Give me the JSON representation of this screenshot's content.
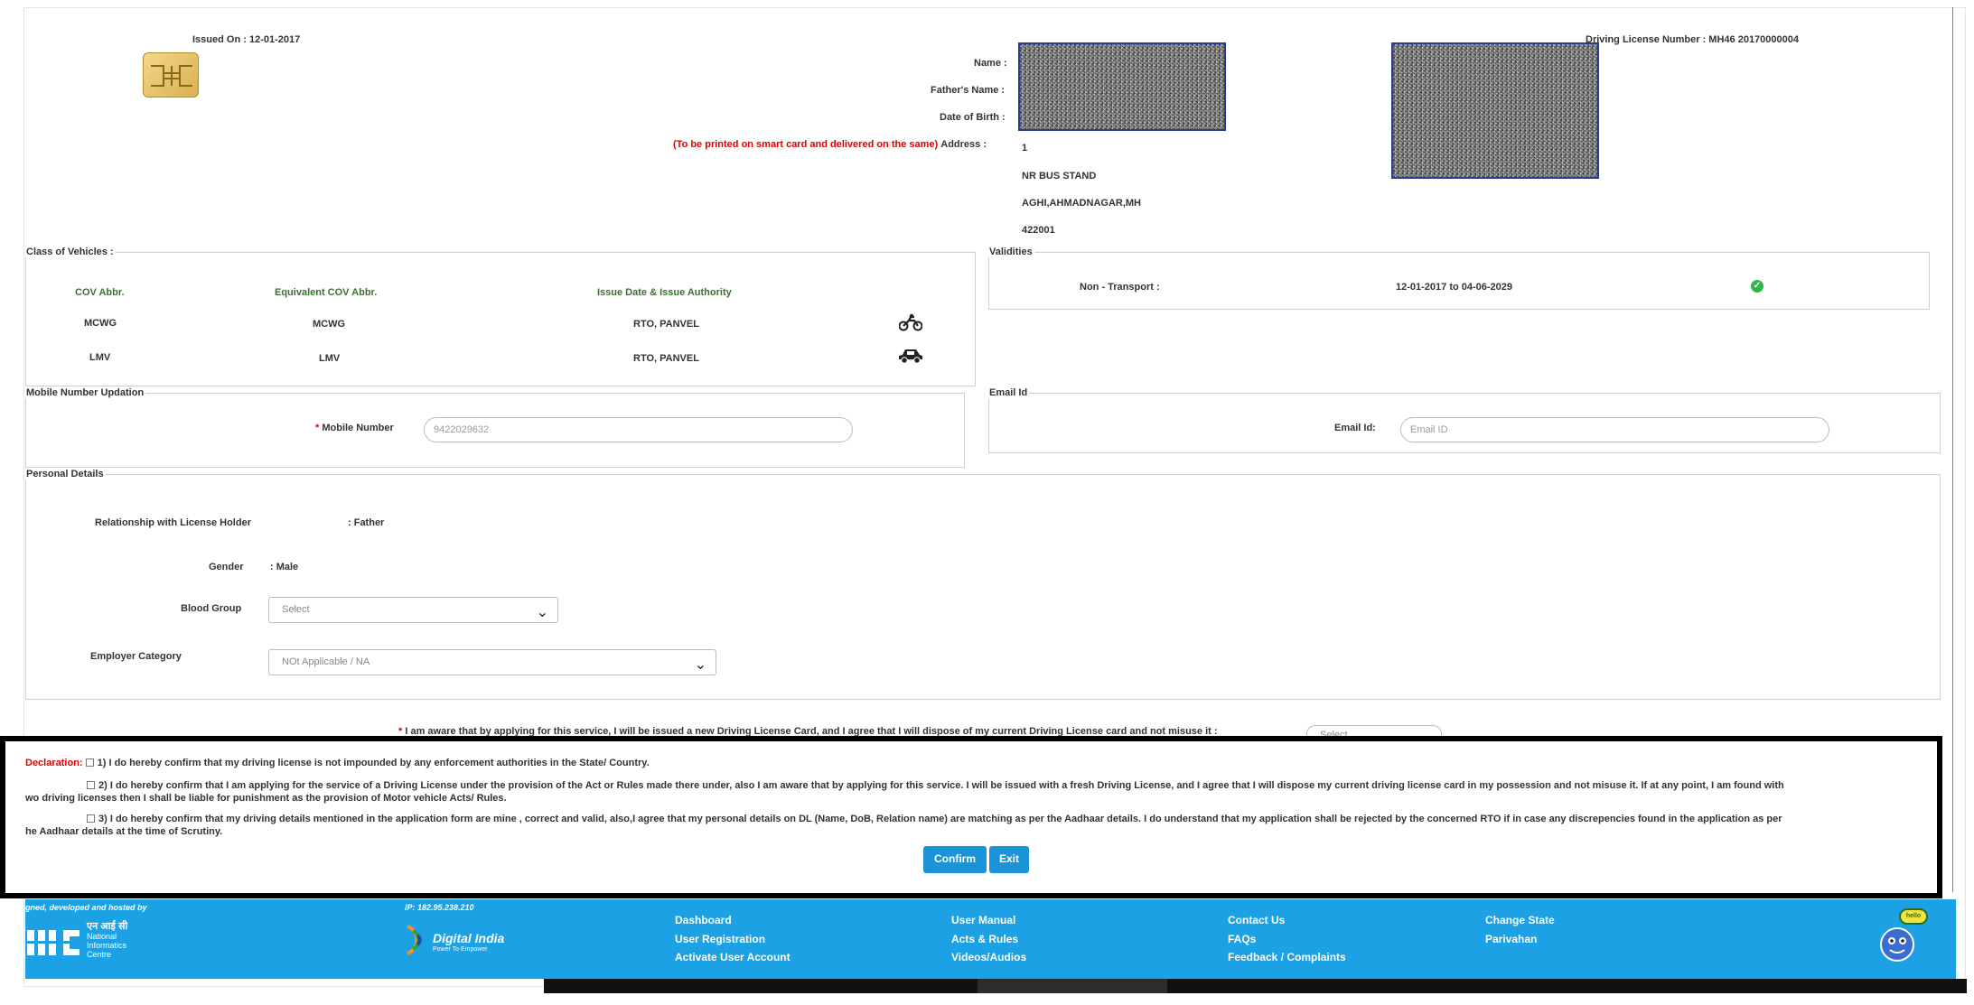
{
  "header": {
    "issued_on": "Issued On : 12-01-2017",
    "dl_number": "Driving License Number : MH46 20170000004",
    "name_label": "Name :",
    "father_label": "Father's Name :",
    "dob_label": "Date of Birth :",
    "print_note": "(To be printed on smart card and delivered on the same)",
    "address_label": "Address :",
    "address_lines": [
      "1",
      "NR BUS STAND",
      "AGHI,AHMADNAGAR,MH",
      "422001"
    ]
  },
  "cov": {
    "legend": "Class of Vehicles :",
    "headers": [
      "COV Abbr.",
      "Equivalent COV Abbr.",
      "Issue Date & Issue Authority"
    ],
    "rows": [
      {
        "abbr": "MCWG",
        "equiv": "MCWG",
        "authority": "RTO, PANVEL",
        "icon": "motorcycle-icon"
      },
      {
        "abbr": "LMV",
        "equiv": "LMV",
        "authority": "RTO, PANVEL",
        "icon": "car-icon"
      }
    ]
  },
  "validities": {
    "legend": "Validities",
    "type": "Non - Transport :",
    "range": "12-01-2017 to 04-06-2029",
    "status_color": "#2fb84a"
  },
  "mobile": {
    "legend": "Mobile Number Updation",
    "required": "*",
    "label": "Mobile Number",
    "value": "9422029632"
  },
  "email": {
    "legend": "Email Id",
    "label": "Email Id:",
    "placeholder": "Email ID"
  },
  "personal": {
    "legend": "Personal Details",
    "relationship_label": "Relationship with License Holder",
    "relationship_value": ": Father",
    "gender_label": "Gender",
    "gender_value": ": Male",
    "blood_label": "Blood Group",
    "blood_value": "Select",
    "employer_label": "Employer Category",
    "employer_value": "NOt Applicable / NA"
  },
  "aware": {
    "required": "*",
    "text": "I am aware that by applying for this service, I will be issued a new Driving License Card, and I agree that I will dispose of my current Driving License card and not misuse it :",
    "select": "Select"
  },
  "declaration": {
    "label": "Declaration:",
    "item1": "1) I do hereby confirm that my driving license is not impounded by any enforcement authorities in the State/ Country.",
    "item2a": "2) I do hereby confirm that I am applying for the service of a Driving License under the provision of the Act or Rules made there under, also I am aware that by applying for this service. I will be issued with a fresh Driving License, and I agree that I will dispose my current driving license card in my possession and not misuse it. If at any point, I am found with",
    "item2b": "wo driving licenses then I shall be liable for punishment as the provision of Motor vehicle Acts/ Rules.",
    "item3a": "3) I do hereby confirm that my driving details mentioned in the application form are mine , correct and valid, also,I agree that my personal details on DL (Name, DoB, Relation name) are matching as per the Aadhaar details. I do understand that my application shall be rejected by the concerned RTO if in case any discrepencies found in the application as per",
    "item3b": "he Aadhaar details at the time of Scrutiny."
  },
  "buttons": {
    "confirm": "Confirm",
    "exit": "Exit"
  },
  "footer": {
    "credit": "gned, developed and hosted by",
    "ip": "IP: 182.95.238.210",
    "nic_hindi": "एन आई सी",
    "nic_lines": [
      "National",
      "Informatics",
      "Centre"
    ],
    "digital_india": "Digital India",
    "digital_india_tag": "Power To Empower",
    "links": [
      [
        "Dashboard",
        "User Registration",
        "Activate User Account"
      ],
      [
        "User Manual",
        "Acts & Rules",
        "Videos/Audios"
      ],
      [
        "Contact Us",
        "FAQs",
        "Feedback / Complaints"
      ],
      [
        "Change State",
        "Parivahan"
      ]
    ],
    "bubble": "hello"
  }
}
